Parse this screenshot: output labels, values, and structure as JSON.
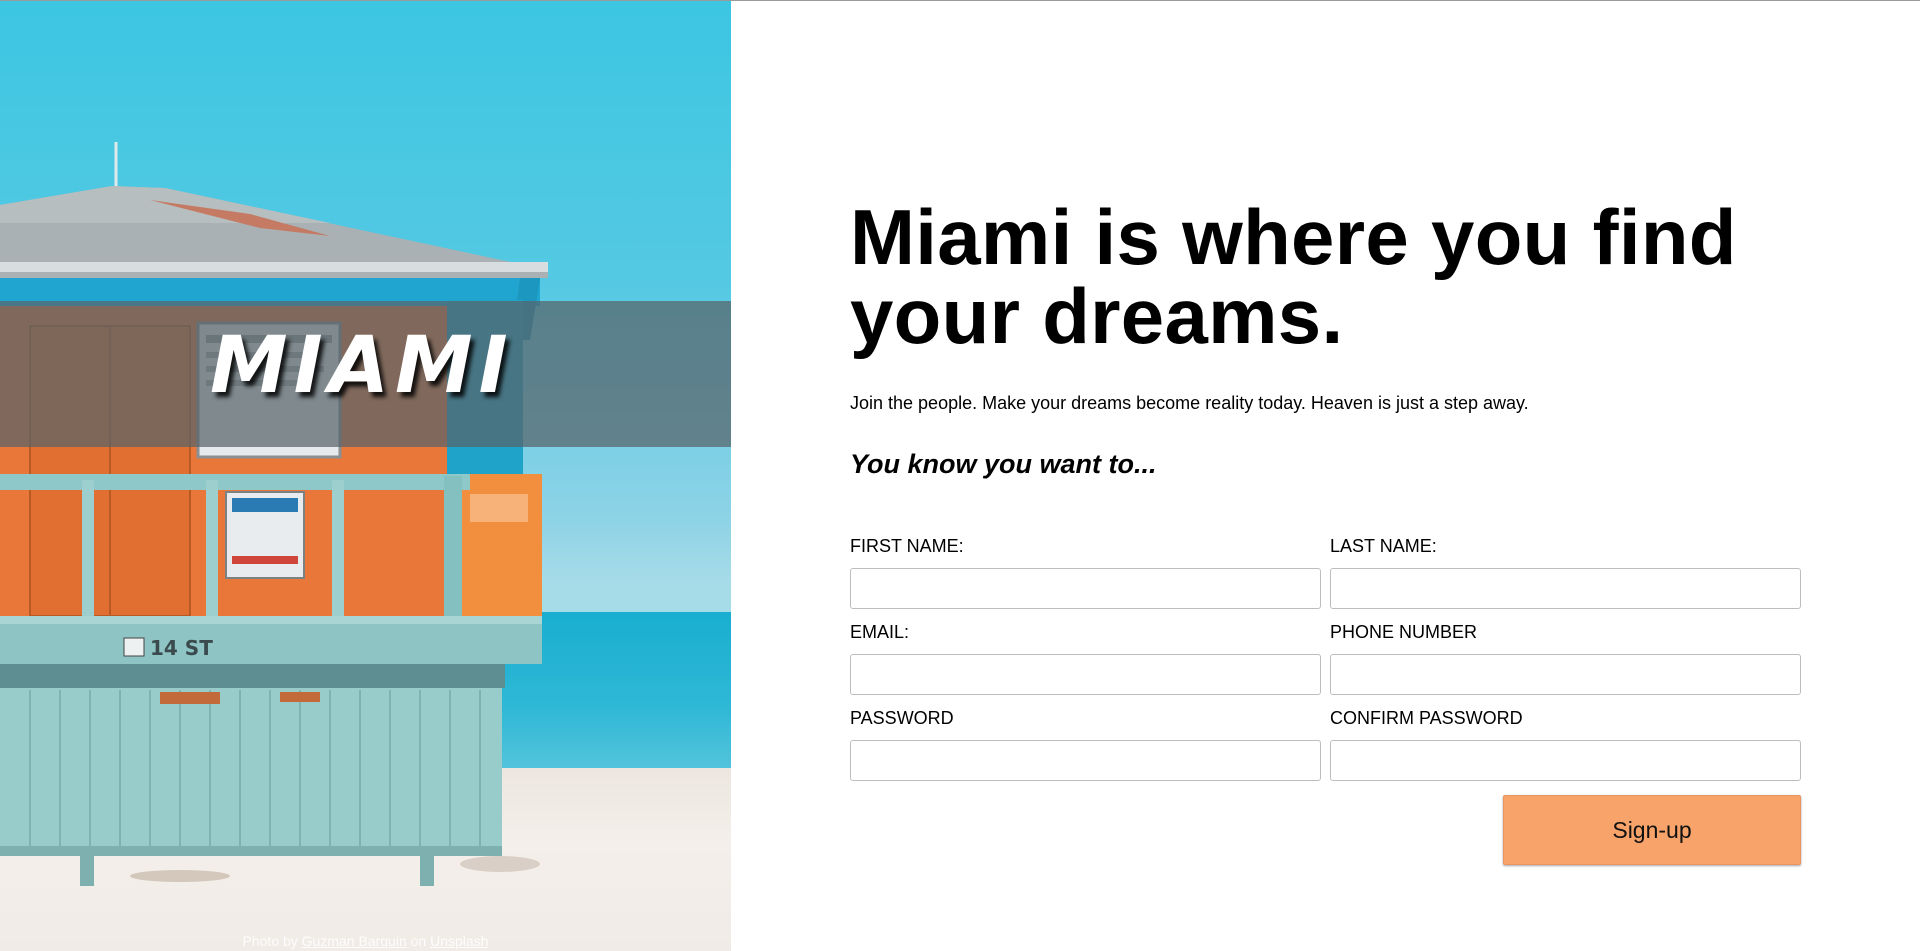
{
  "hero": {
    "logo_text": "MIAMI",
    "hut_sign_text": "14 ST",
    "photo_credit": {
      "prefix": "Photo by",
      "author": "Guzman Barquin",
      "mid": "on",
      "source": "Unsplash"
    }
  },
  "main": {
    "headline": "Miami is where you find your dreams.",
    "subtext": "Join the people. Make your dreams become reality today. Heaven is just a step away.",
    "tagline": "You know you want to..."
  },
  "form": {
    "fields": [
      {
        "label": "FIRST NAME:",
        "value": "",
        "placeholder": ""
      },
      {
        "label": "LAST NAME:",
        "value": "",
        "placeholder": ""
      },
      {
        "label": "EMAIL:",
        "value": "",
        "placeholder": ""
      },
      {
        "label": "PHONE NUMBER",
        "value": "",
        "placeholder": ""
      },
      {
        "label": "PASSWORD",
        "value": "",
        "placeholder": ""
      },
      {
        "label": "CONFIRM PASSWORD",
        "value": "",
        "placeholder": ""
      }
    ],
    "submit_label": "Sign-up"
  },
  "colors": {
    "accent_button": "#f7a369",
    "hero_overlay": "#58646a",
    "sky": "#3cc6e2",
    "hut_orange": "#e9773a",
    "hut_teal": "#8fc8c8"
  }
}
